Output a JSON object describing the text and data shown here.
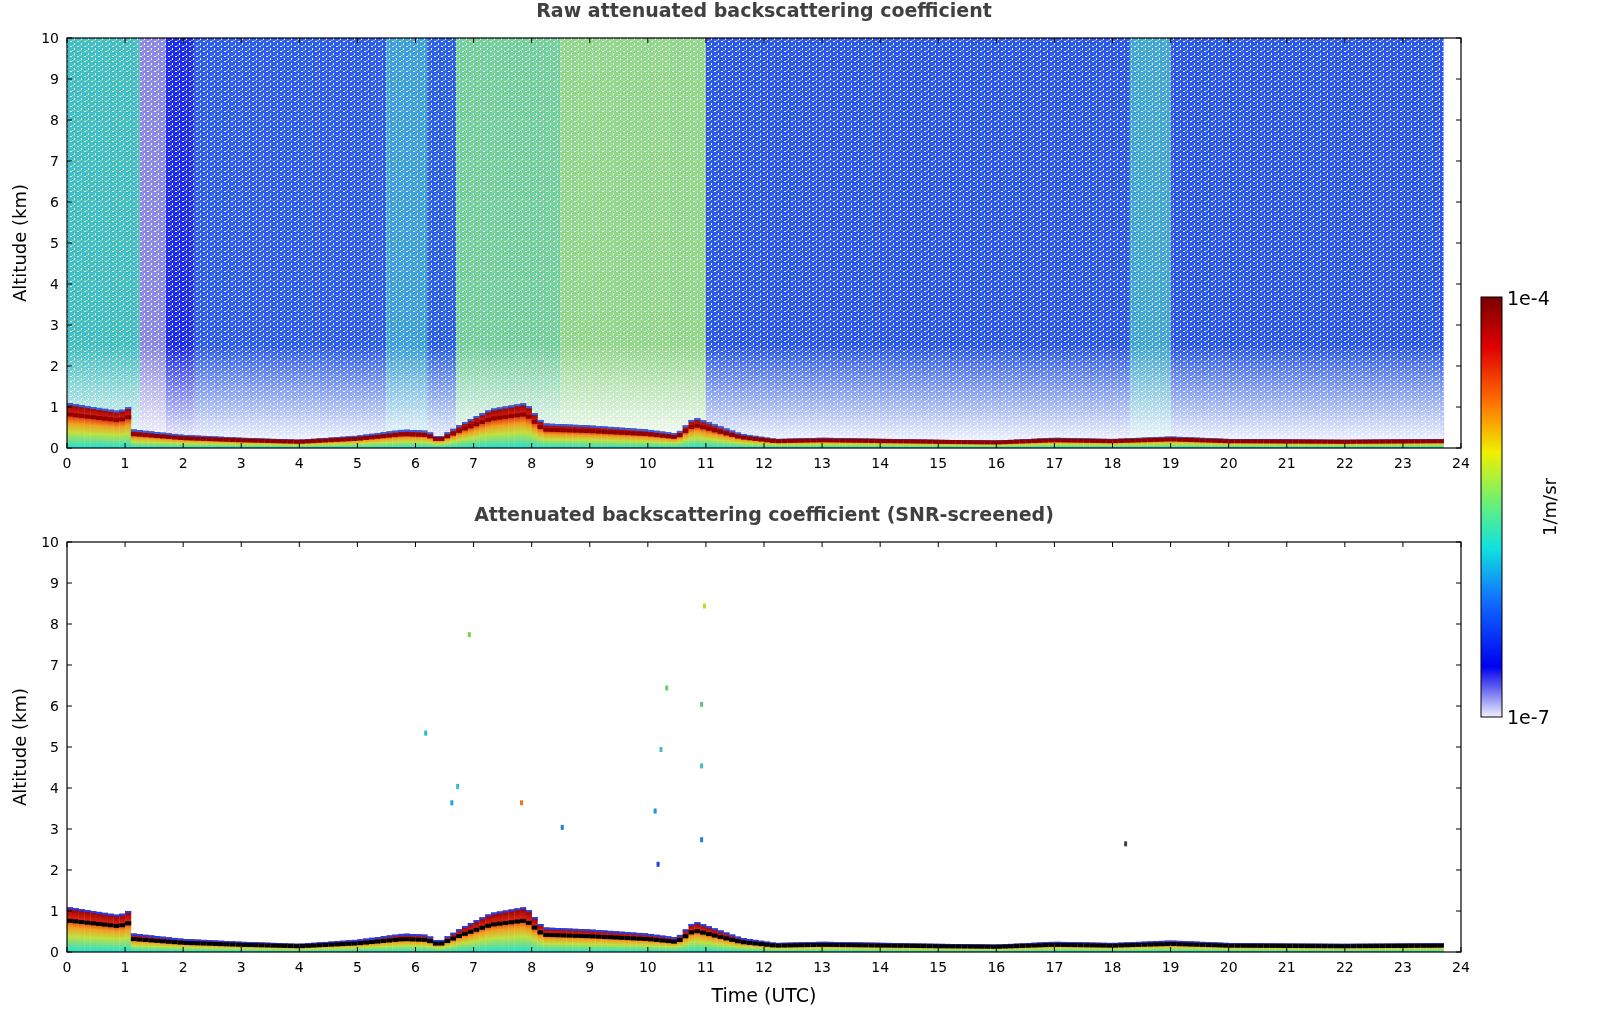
{
  "panels": [
    {
      "kind": "raw",
      "title": "Raw attenuated backscattering coefficient",
      "ylabel": "Altitude (km)",
      "yticks": [
        "10",
        "9",
        "8",
        "7",
        "6",
        "5",
        "4",
        "3",
        "2",
        "1",
        "0"
      ],
      "xticks": [
        "0",
        "1",
        "2",
        "3",
        "4",
        "5",
        "6",
        "7",
        "8",
        "9",
        "10",
        "11",
        "12",
        "13",
        "14",
        "15",
        "16",
        "17",
        "18",
        "19",
        "20",
        "21",
        "22",
        "23",
        "24"
      ]
    },
    {
      "kind": "screened",
      "title": "Attenuated backscattering coefficient (SNR-screened)",
      "ylabel": "Altitude (km)",
      "yticks": [
        "10",
        "9",
        "8",
        "7",
        "6",
        "5",
        "4",
        "3",
        "2",
        "1",
        "0"
      ],
      "xticks": [
        "0",
        "1",
        "2",
        "3",
        "4",
        "5",
        "6",
        "7",
        "8",
        "9",
        "10",
        "11",
        "12",
        "13",
        "14",
        "15",
        "16",
        "17",
        "18",
        "19",
        "20",
        "21",
        "22",
        "23",
        "24"
      ],
      "xlabel": "Time (UTC)"
    }
  ],
  "colorbar": {
    "max_label": "1e-4",
    "min_label": "1e-7",
    "label": "1/m/sr"
  }
}
